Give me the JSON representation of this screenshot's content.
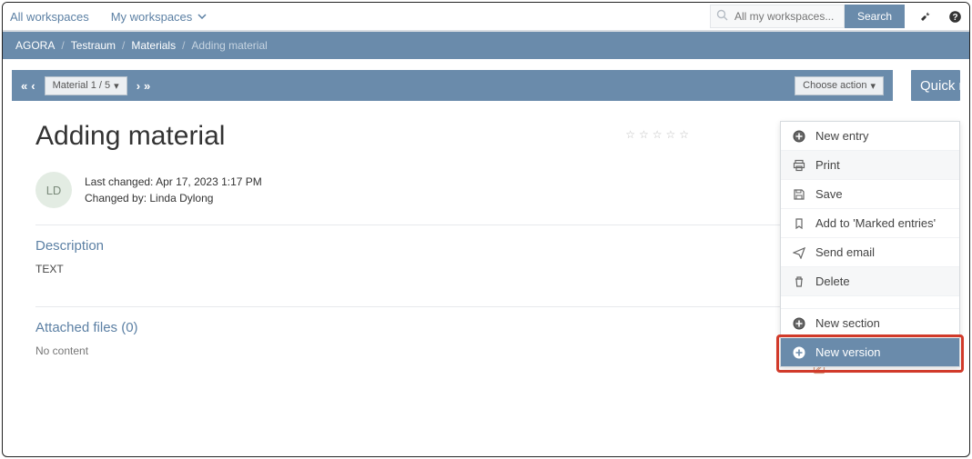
{
  "topbar": {
    "tab_all": "All workspaces",
    "tab_my": "My workspaces",
    "search_placeholder": "All my workspaces...",
    "search_button": "Search"
  },
  "breadcrumb": {
    "a": "AGORA",
    "b": "Testraum",
    "c": "Materials",
    "current": "Adding material"
  },
  "panelhead": {
    "material_label": "Material 1 / 5",
    "choose_label": "Choose action"
  },
  "page": {
    "title": "Adding material",
    "avatar_initials": "LD",
    "last_changed": "Last changed: Apr 17, 2023 1:17 PM",
    "changed_by": "Changed by: Linda Dylong",
    "section_description": "Description",
    "description_text": "TEXT",
    "section_files": "Attached files (0)",
    "no_content": "No content"
  },
  "rightcol_label": "Quick n",
  "menu": {
    "new_entry": "New entry",
    "print": "Print",
    "save": "Save",
    "add_marked": "Add to 'Marked entries'",
    "send_email": "Send email",
    "delete": "Delete",
    "new_section": "New section",
    "new_version": "New version"
  }
}
